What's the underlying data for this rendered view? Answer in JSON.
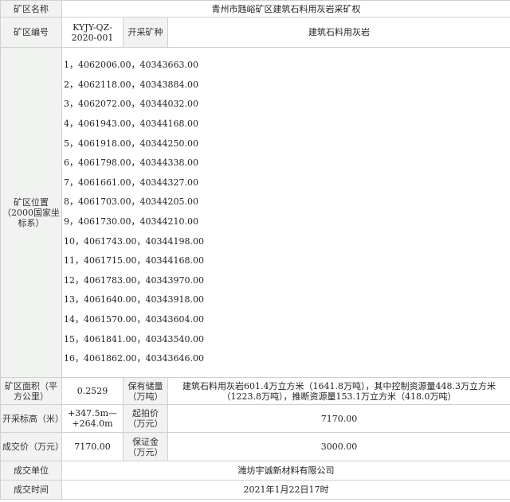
{
  "labels": {
    "name": "矿区名称",
    "code": "矿区编号",
    "mineral": "开采矿种",
    "position": "矿区位置（2000国家坐标系）",
    "area": "矿区面积（平方公里）",
    "reserve": "保有储量（万吨）",
    "elevation": "开采标高（米）",
    "start_price": "起拍价（万元）",
    "deal_price": "成交价（万元）",
    "deposit": "保证金（万元）",
    "buyer": "成交单位",
    "deal_time": "成交时间"
  },
  "values": {
    "name": "青州市韪峪矿区建筑石料用灰岩采矿权",
    "code": "KYJY-QZ-2020-001",
    "mineral": "建筑石料用灰岩",
    "area": "0.2529",
    "reserve": "建筑石料用灰岩601.4万立方米（1641.8万吨），其中控制资源量448.3万立方米（1223.8万吨），推断资源量153.1万立方米（418.0万吨）",
    "elevation": "+347.5m—+264.0m",
    "start_price": "7170.00",
    "deal_price": "7170.00",
    "deposit": "3000.00",
    "buyer": "潍坊宇诚新材料有限公司",
    "deal_time": "2021年1月22日17时"
  },
  "coordinates": [
    "1，4062006.00，40343663.00",
    "2，4062118.00，40343884.00",
    "3，4062072.00，40344032.00",
    "4，4061943.00，40344168.00",
    "5，4061918.00，40344250.00",
    "6，4061798.00，40344338.00",
    "7，4061661.00，40344327.00",
    "8，4061703.00，40344205.00",
    "9，4061730.00，40344210.00",
    "10，4061743.00，40344198.00",
    "11，4061715.00，40344168.00",
    "12，4061783.00，40343970.00",
    "13，4061640.00，40343918.00",
    "14，4061570.00，40343604.00",
    "15，4061841.00，40343540.00",
    "16，4061862.00，40343646.00"
  ]
}
